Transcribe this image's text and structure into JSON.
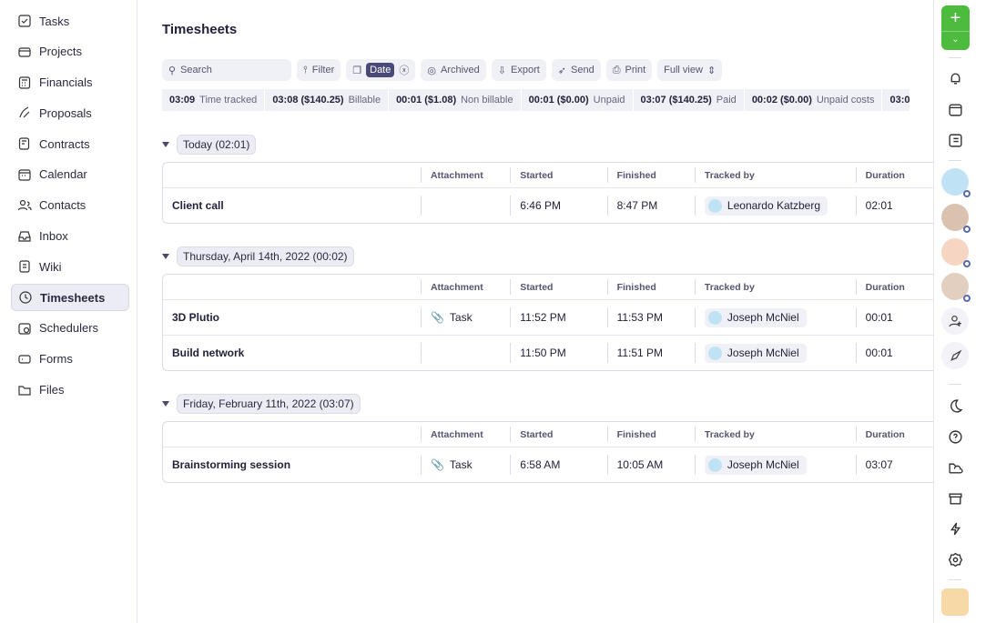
{
  "sidebar": {
    "items": [
      {
        "label": "Tasks",
        "icon": "checkbox-icon"
      },
      {
        "label": "Projects",
        "icon": "folder-icon"
      },
      {
        "label": "Financials",
        "icon": "calculator-icon"
      },
      {
        "label": "Proposals",
        "icon": "pen-icon"
      },
      {
        "label": "Contracts",
        "icon": "contract-icon"
      },
      {
        "label": "Calendar",
        "icon": "calendar-icon"
      },
      {
        "label": "Contacts",
        "icon": "contacts-icon"
      },
      {
        "label": "Inbox",
        "icon": "inbox-icon"
      },
      {
        "label": "Wiki",
        "icon": "wiki-icon"
      },
      {
        "label": "Timesheets",
        "icon": "clock-icon",
        "active": true
      },
      {
        "label": "Schedulers",
        "icon": "scheduler-icon"
      },
      {
        "label": "Forms",
        "icon": "form-icon"
      },
      {
        "label": "Files",
        "icon": "files-icon"
      }
    ]
  },
  "page": {
    "title": "Timesheets"
  },
  "toolbar": {
    "search_placeholder": "Search",
    "filter": "Filter",
    "date": "Date",
    "archived": "Archived",
    "export": "Export",
    "send": "Send",
    "print": "Print",
    "view": "Full view"
  },
  "stats": [
    {
      "value": "03:09",
      "label": "Time tracked"
    },
    {
      "value": "03:08 ($140.25)",
      "label": "Billable"
    },
    {
      "value": "00:01 ($1.08)",
      "label": "Non billable"
    },
    {
      "value": "00:01 ($0.00)",
      "label": "Unpaid"
    },
    {
      "value": "03:07 ($140.25)",
      "label": "Paid"
    },
    {
      "value": "00:02 ($0.00)",
      "label": "Unpaid costs"
    },
    {
      "value": "03:0",
      "label": ""
    }
  ],
  "columns": [
    "",
    "Attachment",
    "Started",
    "Finished",
    "Tracked by",
    "Duration"
  ],
  "groups": [
    {
      "title": "Today (02:01)",
      "rows": [
        {
          "name": "Client call",
          "attachment": "",
          "started": "6:46 PM",
          "finished": "8:47 PM",
          "tracked_by": "Leonardo Katzberg",
          "duration": "02:01"
        }
      ]
    },
    {
      "title": "Thursday, April 14th, 2022 (00:02)",
      "rows": [
        {
          "name": "3D Plutio",
          "attachment": "Task",
          "started": "11:52 PM",
          "finished": "11:53 PM",
          "tracked_by": "Joseph McNiel",
          "duration": "00:01"
        },
        {
          "name": "Build network",
          "attachment": "",
          "started": "11:50 PM",
          "finished": "11:51 PM",
          "tracked_by": "Joseph McNiel",
          "duration": "00:01"
        }
      ]
    },
    {
      "title": "Friday, February 11th, 2022 (03:07)",
      "rows": [
        {
          "name": "Brainstorming session",
          "attachment": "Task",
          "started": "6:58 AM",
          "finished": "10:05 AM",
          "tracked_by": "Joseph McNiel",
          "duration": "03:07"
        }
      ]
    }
  ],
  "colors": {
    "accent": "#4cbb3e",
    "active_pill": "#4a4a78"
  }
}
